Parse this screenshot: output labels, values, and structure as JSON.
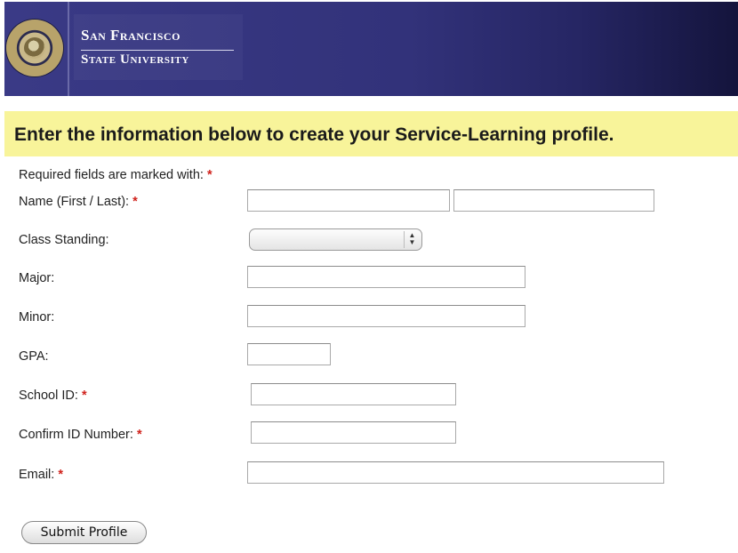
{
  "header": {
    "logo_line1": "San Francisco",
    "logo_line2": "State University",
    "seal_icon": "university-seal-icon"
  },
  "banner": {
    "text": "Enter the information below to create your Service-Learning profile.",
    "background": "#f8f49a"
  },
  "form": {
    "required_note": "Required fields are marked with:",
    "required_marker": "*",
    "required_color": "#d0211b",
    "name_label": "Name (First / Last):",
    "first_name_value": "",
    "last_name_value": "",
    "class_standing_label": "Class Standing:",
    "class_standing_value": "",
    "major_label": "Major:",
    "major_value": "",
    "minor_label": "Minor:",
    "minor_value": "",
    "gpa_label": "GPA:",
    "gpa_value": "",
    "school_id_label": "School ID:",
    "school_id_value": "",
    "confirm_id_label": "Confirm ID Number:",
    "confirm_id_value": "",
    "email_label": "Email:",
    "email_value": "",
    "submit_label": "Submit Profile"
  },
  "colors": {
    "header_blue": "#32327a"
  }
}
